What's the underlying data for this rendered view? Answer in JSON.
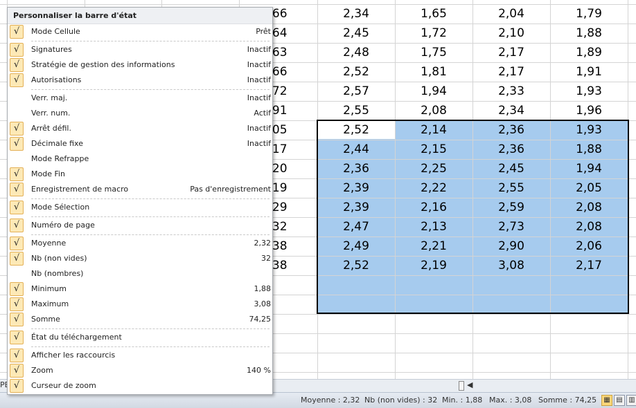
{
  "grid": {
    "partial_column": [
      ",66",
      ",64",
      ",63",
      ",66",
      ",72",
      ",91",
      ",05",
      ",17",
      ",20",
      ",19",
      ",29",
      ",32",
      ",38",
      ",38"
    ],
    "rows": [
      [
        "2,34",
        "1,65",
        "2,04",
        "1,79"
      ],
      [
        "2,45",
        "1,72",
        "2,10",
        "1,88"
      ],
      [
        "2,48",
        "1,75",
        "2,17",
        "1,89"
      ],
      [
        "2,52",
        "1,81",
        "2,17",
        "1,91"
      ],
      [
        "2,57",
        "1,94",
        "2,33",
        "1,93"
      ],
      [
        "2,55",
        "2,08",
        "2,34",
        "1,96"
      ],
      [
        "2,52",
        "2,14",
        "2,36",
        "1,93"
      ],
      [
        "2,44",
        "2,15",
        "2,36",
        "1,88"
      ],
      [
        "2,36",
        "2,25",
        "2,45",
        "1,94"
      ],
      [
        "2,39",
        "2,22",
        "2,55",
        "2,05"
      ],
      [
        "2,39",
        "2,16",
        "2,59",
        "2,08"
      ],
      [
        "2,47",
        "2,13",
        "2,73",
        "2,08"
      ],
      [
        "2,49",
        "2,21",
        "2,90",
        "2,06"
      ],
      [
        "2,52",
        "2,19",
        "3,08",
        "2,17"
      ]
    ],
    "selection_color": "#a6cbee"
  },
  "sheet_tab_fragment": "PE",
  "menu": {
    "title": "Personnaliser la barre d'état",
    "items": [
      {
        "label": "Mode Cellule",
        "value": "Prêt",
        "checked": true
      },
      {
        "sep": true
      },
      {
        "label": "Signatures",
        "value": "Inactif",
        "checked": true
      },
      {
        "label": "Stratégie de gestion des informations",
        "value": "Inactif",
        "checked": true
      },
      {
        "label": "Autorisations",
        "value": "Inactif",
        "checked": true
      },
      {
        "sep": true
      },
      {
        "label": "Verr. maj.",
        "value": "Inactif",
        "checked": false
      },
      {
        "label": "Verr. num.",
        "value": "Actif",
        "checked": false
      },
      {
        "label": "Arrêt défil.",
        "value": "Inactif",
        "checked": true
      },
      {
        "label": "Décimale fixe",
        "value": "Inactif",
        "checked": true
      },
      {
        "label": "Mode Refrappe",
        "value": "",
        "checked": false
      },
      {
        "label": "Mode Fin",
        "value": "",
        "checked": true
      },
      {
        "label": "Enregistrement de macro",
        "value": "Pas d'enregistrement",
        "checked": true
      },
      {
        "sep": true
      },
      {
        "label": "Mode Sélection",
        "value": "",
        "checked": true
      },
      {
        "sep": true
      },
      {
        "label": "Numéro de page",
        "value": "",
        "checked": true
      },
      {
        "sep": true
      },
      {
        "label": "Moyenne",
        "value": "2,32",
        "checked": true
      },
      {
        "label": "Nb (non vides)",
        "value": "32",
        "checked": true
      },
      {
        "label": "Nb (nombres)",
        "value": "",
        "checked": false
      },
      {
        "label": "Minimum",
        "value": "1,88",
        "checked": true
      },
      {
        "label": "Maximum",
        "value": "3,08",
        "checked": true
      },
      {
        "label": "Somme",
        "value": "74,25",
        "checked": true
      },
      {
        "sep": true
      },
      {
        "label": "État du téléchargement",
        "value": "",
        "checked": true
      },
      {
        "sep": true
      },
      {
        "label": "Afficher les raccourcis",
        "value": "",
        "checked": true
      },
      {
        "label": "Zoom",
        "value": "140 %",
        "checked": true
      },
      {
        "label": "Curseur de zoom",
        "value": "",
        "checked": true
      }
    ]
  },
  "status": {
    "average": "Moyenne : 2,32",
    "count": "Nb (non vides) : 32",
    "min": "Min. : 1,88",
    "max": "Max. : 3,08",
    "sum": "Somme : 74,25",
    "views": [
      "normal-view-icon",
      "page-layout-icon",
      "page-break-icon"
    ]
  },
  "checkmark": "√"
}
